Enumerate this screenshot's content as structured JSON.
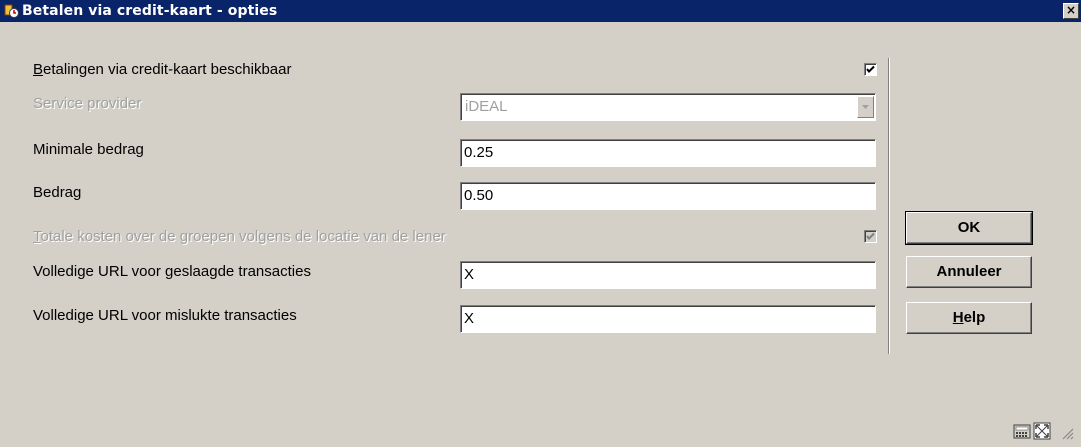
{
  "window": {
    "title": "Betalen via credit-kaart - opties",
    "close_label": "×"
  },
  "form": {
    "enable_label_mnemonic": "B",
    "enable_label_rest": "etalingen via credit-kaart beschikbaar",
    "enable_checked": true,
    "provider_label": "Service provider",
    "provider_value": "iDEAL",
    "min_amount_label": "Minimale bedrag",
    "min_amount_value": "0.25",
    "amount_label": "Bedrag",
    "amount_value": "0.50",
    "total_costs_label_mnemonic": "T",
    "total_costs_label_rest": "otale kosten over de groepen volgens de locatie van de lener",
    "total_costs_checked": true,
    "success_url_label": "Volledige URL voor geslaagde transacties",
    "success_url_value": "X",
    "failed_url_label": "Volledige URL voor mislukte transacties",
    "failed_url_value": "X"
  },
  "buttons": {
    "ok_label": "OK",
    "cancel_label": "Annuleer",
    "help_mnemonic": "H",
    "help_rest": "elp"
  },
  "icons": [
    "app-icon",
    "close-icon",
    "chevron-down-icon",
    "calculator-icon",
    "resize-icon"
  ]
}
